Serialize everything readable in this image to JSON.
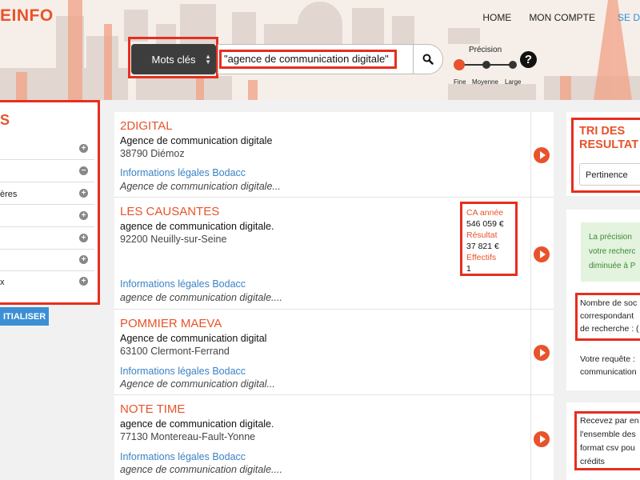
{
  "header": {
    "logo_prefix": "E",
    "logo_suffix": "INFO",
    "nav": [
      "HOME",
      "MON COMPTE",
      "SE D"
    ]
  },
  "search": {
    "mode_label": "Mots clés",
    "query": "\"agence de communication digitale\"",
    "precision_title": "Précision",
    "precision_levels": [
      "Fine",
      "Moyenne",
      "Large"
    ],
    "precision_selected": "Fine"
  },
  "filters": {
    "title": "S",
    "rows": [
      {
        "label": "",
        "toggle": "+"
      },
      {
        "label": "",
        "toggle": "−"
      },
      {
        "label": "ères",
        "toggle": "+"
      },
      {
        "label": "",
        "toggle": "+"
      },
      {
        "label": "",
        "toggle": "+"
      },
      {
        "label": "",
        "toggle": "+"
      },
      {
        "label": "x",
        "toggle": "+"
      }
    ],
    "reset_label": "ITIALISER"
  },
  "results": [
    {
      "name": "2DIGITAL",
      "activity": "Agence de communication digitale",
      "address": "38790 Diémoz",
      "link": "Informations légales Bodacc",
      "snippet_a": "Agence",
      "snippet_b": " de ",
      "snippet_c": "communication digitale..."
    },
    {
      "name": "LES CAUSANTES",
      "activity": "agence de communication digitale.",
      "address": "92200 Neuilly-sur-Seine",
      "link": "Informations légales Bodacc",
      "snippet_a": "agence",
      "snippet_b": " de ",
      "snippet_c": "communication digitale....",
      "financials": {
        "ca_label": "CA année",
        "ca_value": "546 059 €",
        "result_label": "Résultat",
        "result_value": "37 821 €",
        "staff_label": "Effectifs",
        "staff_value": "1"
      }
    },
    {
      "name": "POMMIER MAEVA",
      "activity": "Agence de communication digital",
      "address": "63100 Clermont-Ferrand",
      "link": "Informations légales Bodacc",
      "snippet_a": "Agence",
      "snippet_b": " de ",
      "snippet_c": "communication digital..."
    },
    {
      "name": "NOTE TIME",
      "activity": "agence de communication digitale.",
      "address": "77130 Montereau-Fault-Yonne",
      "link": "Informations légales Bodacc",
      "snippet_a": "agence",
      "snippet_b": " de ",
      "snippet_c": "communication digitale...."
    }
  ],
  "sidebar": {
    "sort_title_1": "TRI DES",
    "sort_title_2": "RESULTAT",
    "sort_value": "Pertinence",
    "notice_lines": [
      "La précision",
      "votre recherc",
      "diminuée à P"
    ],
    "count_lines": [
      "Nombre de soc",
      "correspondant",
      "de recherche : ("
    ],
    "request_lines": [
      "Votre requête :",
      "communication"
    ],
    "export_lines": [
      "Recevez par en",
      "l'ensemble des",
      "format csv pou",
      "crédits"
    ]
  },
  "colors": {
    "accent": "#e8532b",
    "highlight_border": "#e62e1f",
    "link": "#3b82c4",
    "button_blue": "#3b8fd4",
    "notice_bg": "#e3f3de"
  }
}
